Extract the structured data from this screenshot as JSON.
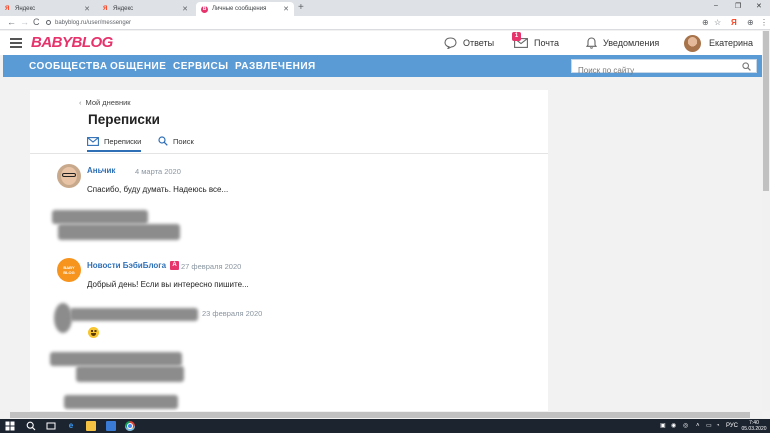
{
  "browser": {
    "tabs": [
      {
        "title": "Яндекс",
        "favicon": "Я"
      },
      {
        "title": "Яндекс",
        "favicon": "Я"
      },
      {
        "title": "Личные сообщения",
        "favicon": "B"
      }
    ],
    "url": "babyblog.ru/user/messenger",
    "controls": {
      "back": "←",
      "forward": "→",
      "reload": "C",
      "new_tab": "+",
      "minimize": "–",
      "restore": "❐",
      "close": "✕"
    },
    "toolbar_icons": {
      "zoom": "⊕",
      "star": "☆",
      "yandex": "Я",
      "account": "⊕",
      "menu": "⋮"
    }
  },
  "header": {
    "logo": "BABYBLOG",
    "answers_label": "Ответы",
    "mail_label": "Почта",
    "mail_badge": "1",
    "notifications_label": "Уведомления",
    "user_name": "Екатерина"
  },
  "nav": {
    "items": [
      "СООБЩЕСТВА",
      "ОБЩЕНИЕ",
      "СЕРВИСЫ",
      "РАЗВЛЕЧЕНИЯ"
    ],
    "search_placeholder": "Поиск по сайту"
  },
  "content": {
    "back_link": "Мой дневник",
    "title": "Переписки",
    "tabs": [
      "Переписки",
      "Поиск"
    ],
    "messages": [
      {
        "author": "Аньчик",
        "date": "4 марта 2020",
        "text": "Спасибо, буду думать. Надеюсь все..."
      },
      {
        "author": "Новости БэбиБлога",
        "badge": "A",
        "date": "27 февраля 2020",
        "text": "Добрый день! Если вы интересно пишите..."
      },
      {
        "date": "23 февраля 2020"
      }
    ]
  },
  "taskbar": {
    "language": "РУС",
    "time": "7:40",
    "date": "05.03.2020"
  },
  "colors": {
    "brand_pink": "#e6336c",
    "nav_blue": "#5b9bd5",
    "link_blue": "#2f6fb6"
  }
}
